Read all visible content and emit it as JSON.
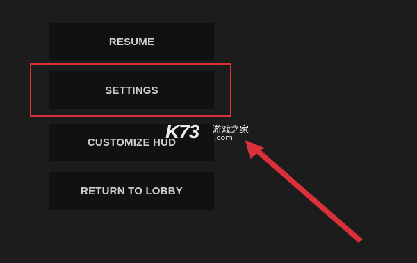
{
  "pause_menu": {
    "buttons": [
      {
        "label": "RESUME"
      },
      {
        "label": "SETTINGS"
      },
      {
        "label": "CUSTOMIZE HUD"
      },
      {
        "label": "RETURN TO LOBBY"
      }
    ]
  },
  "annotation": {
    "highlight_color": "#d9303a",
    "highlighted_item": "SETTINGS",
    "arrow_color": "#d9303a"
  },
  "watermark": {
    "logo": "K73",
    "site_name": "游戏之家",
    "domain": ".com"
  },
  "colors": {
    "background": "#1c1c1c",
    "button_background": "#111111",
    "button_text": "#cfcfcf"
  }
}
